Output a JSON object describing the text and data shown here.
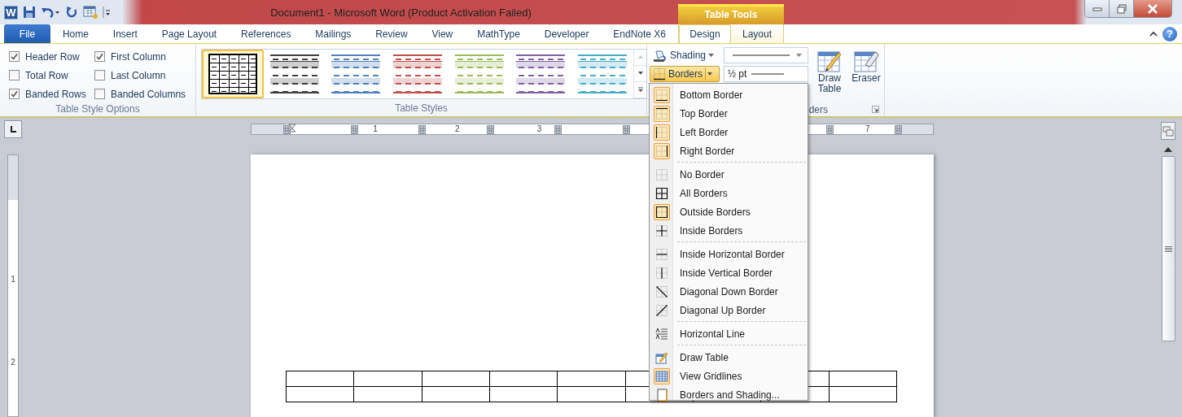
{
  "title_bar": {
    "app_icon": "W",
    "title": "Document1  -  Microsoft Word (Product Activation Failed)",
    "contextual_header": "Table Tools"
  },
  "tabs": [
    {
      "label": "File",
      "kind": "file",
      "selected": false
    },
    {
      "label": "Home",
      "kind": "main",
      "selected": false
    },
    {
      "label": "Insert",
      "kind": "main",
      "selected": false
    },
    {
      "label": "Page Layout",
      "kind": "main",
      "selected": false
    },
    {
      "label": "References",
      "kind": "main",
      "selected": false
    },
    {
      "label": "Mailings",
      "kind": "main",
      "selected": false
    },
    {
      "label": "Review",
      "kind": "main",
      "selected": false
    },
    {
      "label": "View",
      "kind": "main",
      "selected": false
    },
    {
      "label": "MathType",
      "kind": "main",
      "selected": false
    },
    {
      "label": "Developer",
      "kind": "main",
      "selected": false
    },
    {
      "label": "EndNote X6",
      "kind": "main",
      "selected": false
    },
    {
      "label": "Design",
      "kind": "contextual",
      "selected": true
    },
    {
      "label": "Layout",
      "kind": "contextual",
      "selected": false
    }
  ],
  "help": "?",
  "ribbon": {
    "table_style_options": {
      "label": "Table Style Options",
      "options": [
        {
          "label": "Header Row",
          "checked": true
        },
        {
          "label": "First Column",
          "checked": true
        },
        {
          "label": "Total Row",
          "checked": false
        },
        {
          "label": "Last Column",
          "checked": false
        },
        {
          "label": "Banded Rows",
          "checked": true
        },
        {
          "label": "Banded Columns",
          "checked": false
        }
      ]
    },
    "table_styles": {
      "label": "Table Styles",
      "styles": [
        {
          "kind": "grid",
          "color": "#000000",
          "selected": true
        },
        {
          "kind": "banded",
          "color": "#404040",
          "selected": false
        },
        {
          "kind": "banded",
          "color": "#4f81bd",
          "selected": false
        },
        {
          "kind": "banded",
          "color": "#c0504d",
          "selected": false
        },
        {
          "kind": "banded",
          "color": "#9bbb59",
          "selected": false
        },
        {
          "kind": "banded",
          "color": "#8064a2",
          "selected": false
        },
        {
          "kind": "banded",
          "color": "#4bacc6",
          "selected": false
        }
      ]
    },
    "draw_borders": {
      "label": "ders",
      "shading": {
        "label": "Shading",
        "pressed": false
      },
      "borders": {
        "label": "Borders",
        "pressed": true
      },
      "line_weight": "½ pt",
      "draw_table": {
        "label": "Draw Table",
        "pressed": false
      },
      "eraser": {
        "label": "Eraser",
        "pressed": false
      }
    }
  },
  "ruler": {
    "numbers": [
      "1",
      "2",
      "3",
      "7"
    ]
  },
  "vertical_ruler": {
    "numbers": [
      "1",
      "2"
    ]
  },
  "document": {
    "table": {
      "rows": [
        {
          "cells": [
            {},
            {},
            {},
            {},
            {},
            {},
            {},
            {},
            {}
          ]
        },
        {
          "cells": [
            {},
            {},
            {},
            {},
            {},
            {},
            {},
            {},
            {}
          ]
        }
      ]
    }
  },
  "borders_menu": {
    "sections": [
      {
        "items": [
          {
            "label": "Bottom Border",
            "kind": "bottom",
            "active": true
          },
          {
            "label": "Top Border",
            "kind": "top",
            "active": true
          },
          {
            "label": "Left Border",
            "kind": "left",
            "active": true
          },
          {
            "label": "Right Border",
            "kind": "right",
            "active": true
          }
        ]
      },
      {
        "items": [
          {
            "label": "No Border",
            "kind": "none",
            "active": false
          },
          {
            "label": "All Borders",
            "kind": "all",
            "active": false
          },
          {
            "label": "Outside Borders",
            "kind": "outside",
            "active": true
          },
          {
            "label": "Inside Borders",
            "kind": "inside",
            "active": false
          }
        ]
      },
      {
        "items": [
          {
            "label": "Inside Horizontal Border",
            "kind": "insideh",
            "active": false
          },
          {
            "label": "Inside Vertical Border",
            "kind": "insidev",
            "active": false
          },
          {
            "label": "Diagonal Down Border",
            "kind": "diagdown",
            "active": false
          },
          {
            "label": "Diagonal Up Border",
            "kind": "diagup",
            "active": false
          }
        ]
      },
      {
        "items": [
          {
            "label": "Horizontal Line",
            "kind": "hline",
            "active": false
          }
        ]
      },
      {
        "items": [
          {
            "label": "Draw Table",
            "kind": "draw",
            "active": false
          },
          {
            "label": "View Gridlines",
            "kind": "gridlines",
            "active": true
          },
          {
            "label": "Borders and Shading...",
            "kind": "dialog",
            "active": false
          }
        ]
      }
    ]
  }
}
